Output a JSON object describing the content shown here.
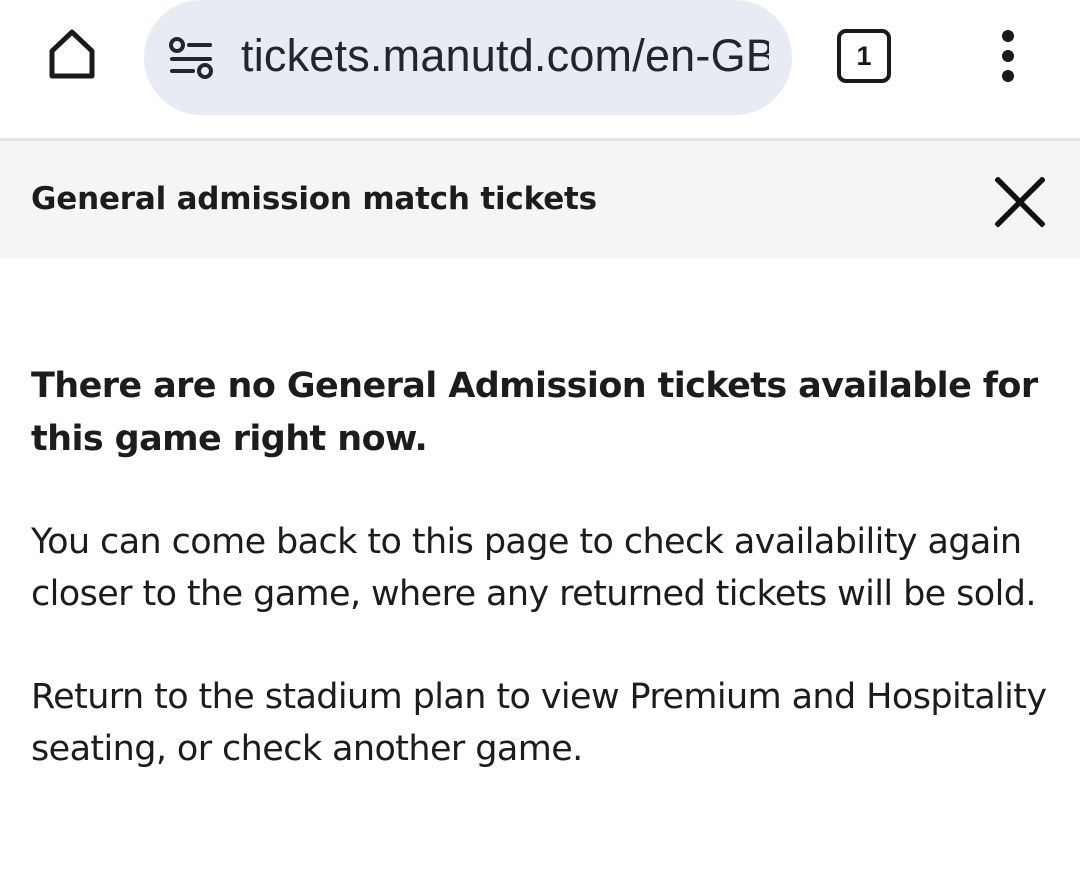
{
  "browser": {
    "url": "tickets.manutd.com/en-GB",
    "tab_count": "1",
    "icons": {
      "home": "home-icon",
      "site_info": "tune-icon",
      "tabs": "tab-switcher-icon",
      "menu": "more-vert-icon"
    }
  },
  "page_header": {
    "title": "General admission match tickets",
    "close_icon": "close-icon"
  },
  "content": {
    "headline": "There are no General Admission tickets available for this game right now.",
    "paragraph_1": "You can come back to this page to check availability again closer to the game, where any returned tickets will be sold.",
    "paragraph_2": "Return to the stadium plan to view Premium and Hospitality seating, or check another game."
  },
  "colors": {
    "omnibox_bg": "#e7ebf4",
    "header_bg": "#f5f5f5",
    "text": "#1c1c1c",
    "divider": "#dde2ea"
  }
}
